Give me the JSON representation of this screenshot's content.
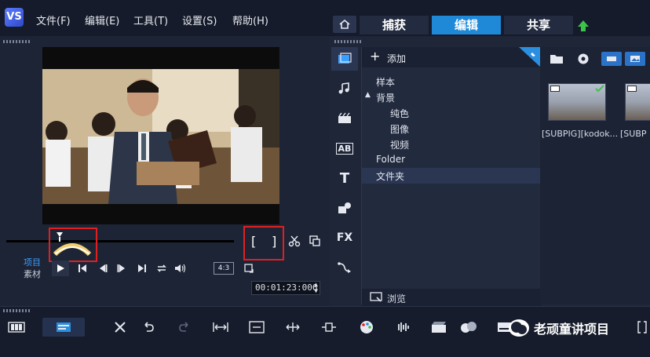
{
  "menu": {
    "items": [
      "文件(F)",
      "编辑(E)",
      "工具(T)",
      "设置(S)",
      "帮助(H)"
    ]
  },
  "nav": {
    "tabs": [
      {
        "label": "捕获",
        "active": false
      },
      {
        "label": "编辑",
        "active": true
      },
      {
        "label": "共享",
        "active": false
      }
    ]
  },
  "player": {
    "mode_project": "项目",
    "mode_clip": "素材",
    "aspect": "4:3",
    "timecode": "00:01:23:006",
    "mark_in": "[",
    "mark_out": "]"
  },
  "library": {
    "add_label": "添加",
    "tree": [
      {
        "label": "样本",
        "level": 0
      },
      {
        "label": "背景",
        "level": 0,
        "expanded": true
      },
      {
        "label": "纯色",
        "level": 1
      },
      {
        "label": "图像",
        "level": 1
      },
      {
        "label": "视频",
        "level": 1
      },
      {
        "label": "Folder",
        "level": 0
      },
      {
        "label": "文件夹",
        "level": 0,
        "selected": true
      }
    ],
    "browse_label": "浏览",
    "side_tools": [
      "media-icon",
      "music-icon",
      "title-instant-icon",
      "ab-transition-icon",
      "title-t-icon",
      "graphic-icon",
      "fx-icon",
      "path-icon"
    ],
    "fx_label": "FX",
    "ab_label": "AB",
    "t_label": "T"
  },
  "media": {
    "thumbs": [
      "[SUBPIG][kodok...",
      "[SUBP"
    ]
  },
  "watermark": {
    "text": "老顽童讲项目"
  },
  "colors": {
    "accent": "#1f89d8",
    "highlight_border": "#e02020",
    "project_text": "#3aa0ff"
  }
}
